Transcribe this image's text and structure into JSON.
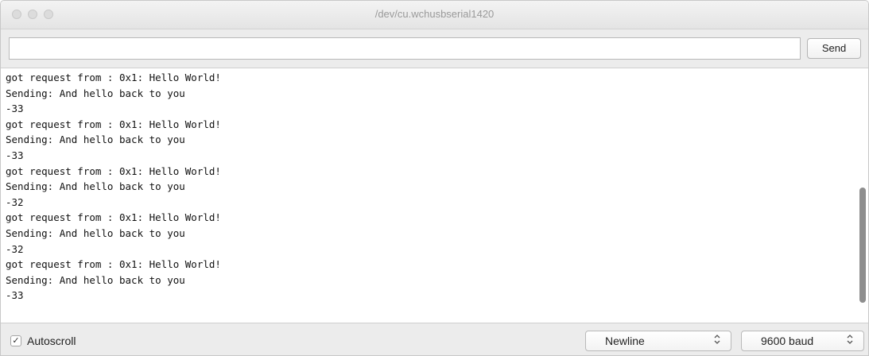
{
  "window": {
    "title": "/dev/cu.wchusbserial1420"
  },
  "input": {
    "value": "",
    "placeholder": ""
  },
  "toolbar": {
    "send_label": "Send"
  },
  "output": {
    "lines": [
      "got request from : 0x1: Hello World!",
      "Sending: And hello back to you",
      "-33",
      "got request from : 0x1: Hello World!",
      "Sending: And hello back to you",
      "-33",
      "got request from : 0x1: Hello World!",
      "Sending: And hello back to you",
      "-32",
      "got request from : 0x1: Hello World!",
      "Sending: And hello back to you",
      "-32",
      "got request from : 0x1: Hello World!",
      "Sending: And hello back to you",
      "-33"
    ],
    "scroll_position": 0.85
  },
  "footer": {
    "autoscroll": {
      "label": "Autoscroll",
      "checked": true,
      "check_glyph": "✓"
    },
    "line_ending": {
      "selected": "Newline",
      "chevron_glyph": "⌃\n⌄"
    },
    "baud_rate": {
      "selected": "9600 baud",
      "chevron_glyph": "⌃\n⌄"
    }
  },
  "icons": {
    "close": "close-icon",
    "minimize": "minimize-icon",
    "zoom": "zoom-icon",
    "checkmark": "checkmark-icon",
    "updown_chevron": "chevron-updown-icon"
  },
  "colors": {
    "window_bg": "#ececec",
    "output_bg": "#ffffff",
    "text": "#111111",
    "title_text": "#9a9a9a",
    "scroll_thumb": "#8e8e8e"
  }
}
